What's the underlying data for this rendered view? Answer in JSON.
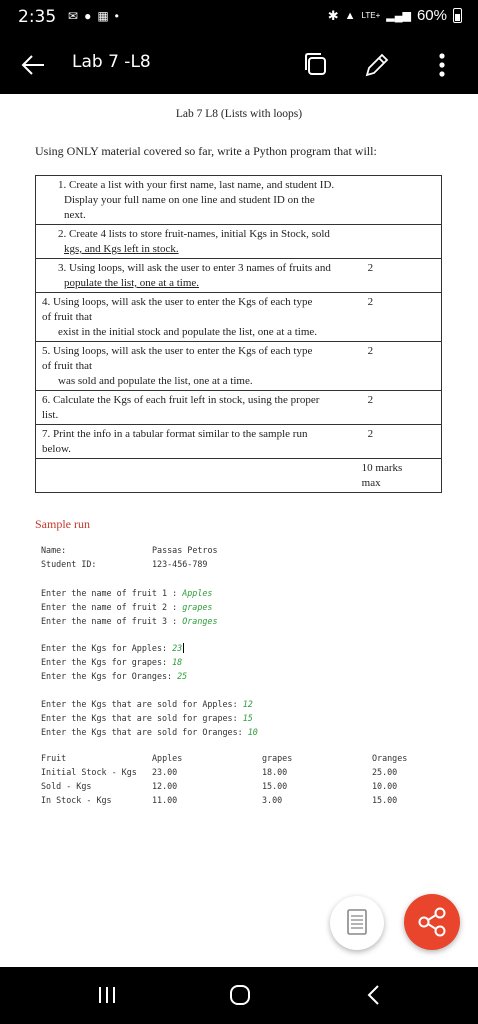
{
  "status": {
    "time": "2:35",
    "battery": "60%",
    "network": "LTE+"
  },
  "app_bar": {
    "title": "Lab 7 -L8"
  },
  "doc": {
    "title": "Lab 7   L8 (Lists with loops)",
    "intro": "Using ONLY material covered so far, write a Python program that will:",
    "tasks": [
      {
        "lines": [
          "1. Create a list with your first name, last name, and student ID.",
          "Display your full name on one line and student ID on the",
          "next."
        ],
        "marks": ""
      },
      {
        "lines": [
          "2. Create 4 lists to store fruit-names, initial Kgs in Stock, sold",
          "kgs, and Kgs left in stock."
        ],
        "marks": ""
      },
      {
        "lines": [
          "3. Using loops, will ask the user to enter 3 names of fruits and",
          "populate the list, one at a time."
        ],
        "marks": "2"
      },
      {
        "lines": [
          "4. Using loops, will ask the user to enter the Kgs of each type",
          "of fruit that",
          "exist in the initial stock and populate the list, one at a time."
        ],
        "marks": "2"
      },
      {
        "lines": [
          "5. Using loops, will ask the user to enter the Kgs of each type",
          "of fruit that",
          "was sold and populate the list, one at a time."
        ],
        "marks": "2"
      },
      {
        "lines": [
          "6. Calculate the Kgs of each fruit left in stock, using the proper",
          "list."
        ],
        "marks": "2"
      },
      {
        "lines": [
          "7. Print the info in a tabular format similar to the sample run",
          "below."
        ],
        "marks": "2"
      }
    ],
    "total_marks": [
      "10 marks",
      "max"
    ],
    "sample_label": "Sample run",
    "sample": {
      "name_label": "Name:",
      "name_value": "Passas Petros",
      "id_label": "Student ID:",
      "id_value": "123-456-789",
      "fruit_prompts": [
        {
          "prompt": "Enter the name of fruit 1 : ",
          "answer": "Apples"
        },
        {
          "prompt": "Enter the name of fruit 2 : ",
          "answer": "grapes"
        },
        {
          "prompt": "Enter the name of fruit 3 : ",
          "answer": "Oranges"
        }
      ],
      "kgs_prompts": [
        {
          "prompt": "Enter the Kgs for Apples: ",
          "answer": "23"
        },
        {
          "prompt": "Enter the Kgs for grapes: ",
          "answer": "18"
        },
        {
          "prompt": "Enter the Kgs for Oranges: ",
          "answer": "25"
        }
      ],
      "sold_prompts": [
        {
          "prompt": "Enter the Kgs that are sold for Apples: ",
          "answer": "12"
        },
        {
          "prompt": "Enter the Kgs that are sold for grapes: ",
          "answer": "15"
        },
        {
          "prompt": "Enter the Kgs that are sold for Oranges: ",
          "answer": "10"
        }
      ],
      "table": {
        "header": [
          "Fruit",
          "Apples",
          "grapes",
          "Oranges"
        ],
        "rows": [
          [
            "Initial Stock - Kgs",
            "23.00",
            "18.00",
            "25.00"
          ],
          [
            "Sold - Kgs",
            "12.00",
            "15.00",
            "10.00"
          ],
          [
            "In Stock - Kgs",
            "11.00",
            "3.00",
            "15.00"
          ]
        ]
      }
    }
  },
  "colors": {
    "share_fab": "#e8452c",
    "accent_red": "#c0392b",
    "input_green": "#2e9e3a"
  }
}
